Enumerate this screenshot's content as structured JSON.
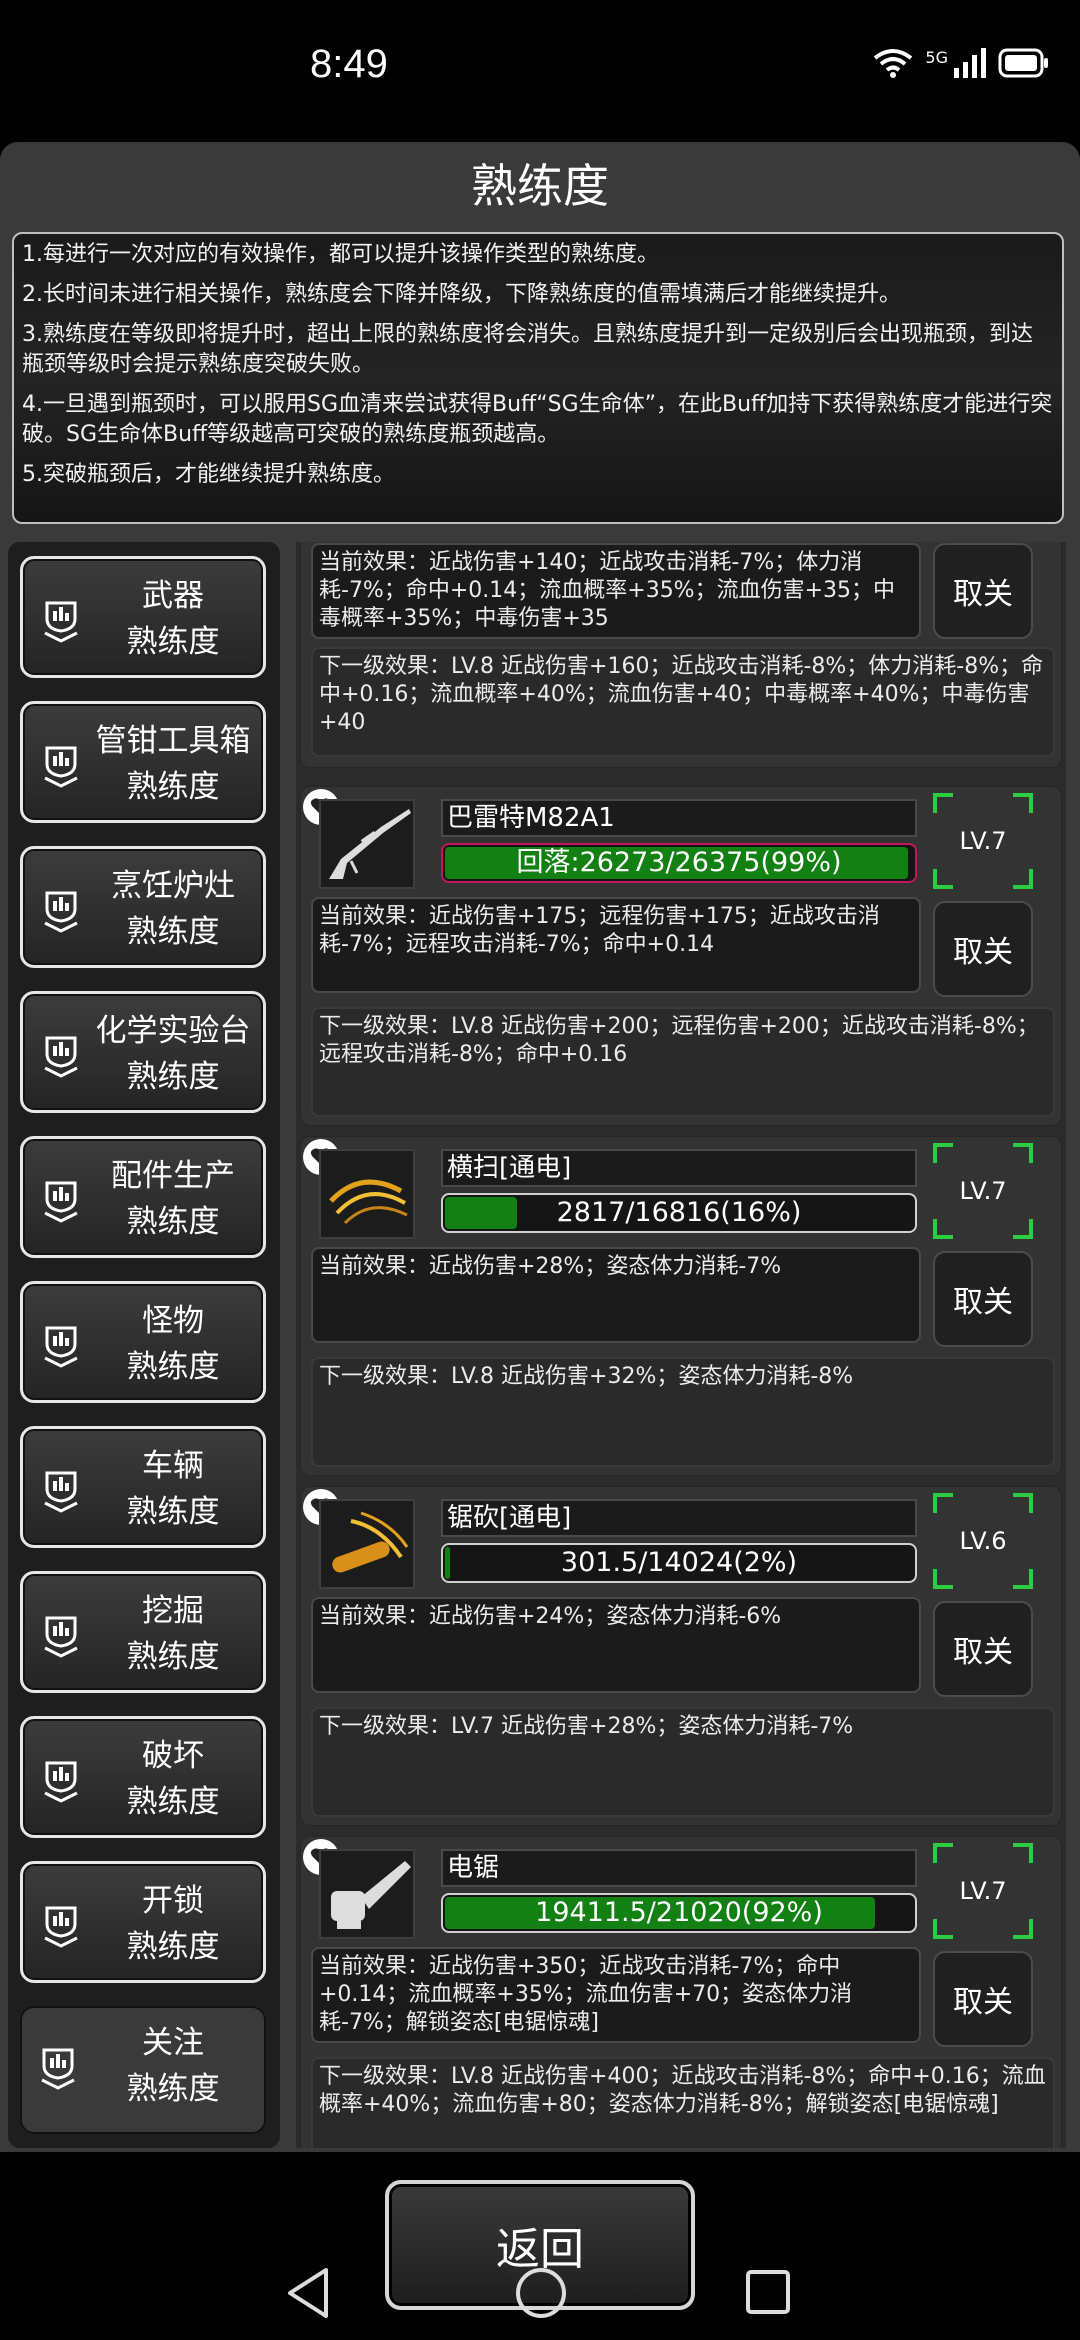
{
  "status_bar": {
    "time": "8:49",
    "network": "5G"
  },
  "title": "熟练度",
  "rules": [
    "1.每进行一次对应的有效操作，都可以提升该操作类型的熟练度。",
    "2.长时间未进行相关操作，熟练度会下降并降级，下降熟练度的值需填满后才能继续提升。",
    "3.熟练度在等级即将提升时，超出上限的熟练度将会消失。且熟练度提升到一定级别后会出现瓶颈，到达瓶颈等级时会提示熟练度突破失败。",
    "4.一旦遇到瓶颈时，可以服用SG血清来尝试获得Buff“SG生命体”，在此Buff加持下获得熟练度才能进行突破。SG生命体Buff等级越高可突破的熟练度瓶颈越高。",
    "5.突破瓶颈后，才能继续提升熟练度。"
  ],
  "menu": [
    {
      "line1": "武器",
      "line2": "熟练度"
    },
    {
      "line1": "管钳工具箱",
      "line2": "熟练度"
    },
    {
      "line1": "烹饪炉灶",
      "line2": "熟练度"
    },
    {
      "line1": "化学实验台",
      "line2": "熟练度"
    },
    {
      "line1": "配件生产",
      "line2": "熟练度"
    },
    {
      "line1": "怪物",
      "line2": "熟练度"
    },
    {
      "line1": "车辆",
      "line2": "熟练度"
    },
    {
      "line1": "挖掘",
      "line2": "熟练度"
    },
    {
      "line1": "破坏",
      "line2": "熟练度"
    },
    {
      "line1": "开锁",
      "line2": "熟练度"
    },
    {
      "line1": "关注",
      "line2": "熟练度",
      "active": true
    }
  ],
  "partial_card": {
    "current": "当前效果：近战伤害+140；近战攻击消耗-7%；体力消耗-7%；命中+0.14；流血概率+35%；流血伤害+35；中毒概率+35%；中毒伤害+35",
    "next": "下一级效果：LV.8 近战伤害+160；近战攻击消耗-8%；体力消耗-8%；命中+0.16；流血概率+40%；流血伤害+40；中毒概率+40%；中毒伤害+40",
    "button": "取关"
  },
  "cards": [
    {
      "name": "巴雷特M82A1",
      "icon": "sniper-rifle-icon",
      "progress_text": "回落:26273/26375(99%)",
      "progress": 0.99,
      "highlight": true,
      "level": "LV.7",
      "current": "当前效果：近战伤害+175；远程伤害+175；近战攻击消耗-7%；远程攻击消耗-7%；命中+0.14",
      "next": "下一级效果：LV.8 近战伤害+200；远程伤害+200；近战攻击消耗-8%；远程攻击消耗-8%；命中+0.16",
      "button": "取关"
    },
    {
      "name": "横扫[通电]",
      "icon": "sweep-slash-icon",
      "progress_text": "2817/16816(16%)",
      "progress": 0.16,
      "highlight": false,
      "level": "LV.7",
      "current": "当前效果：近战伤害+28%；姿态体力消耗-7%",
      "next": "下一级效果：LV.8 近战伤害+32%；姿态体力消耗-8%",
      "button": "取关"
    },
    {
      "name": "锯砍[通电]",
      "icon": "saw-slash-icon",
      "progress_text": "301.5/14024(2%)",
      "progress": 0.02,
      "highlight": false,
      "level": "LV.6",
      "current": "当前效果：近战伤害+24%；姿态体力消耗-6%",
      "next": "下一级效果：LV.7 近战伤害+28%；姿态体力消耗-7%",
      "button": "取关"
    },
    {
      "name": "电锯",
      "icon": "chainsaw-icon",
      "progress_text": "19411.5/21020(92%)",
      "progress": 0.92,
      "highlight": false,
      "level": "LV.7",
      "current": "当前效果：近战伤害+350；近战攻击消耗-7%；命中+0.14；流血概率+35%；流血伤害+70；姿态体力消耗-7%；解锁姿态[电锯惊魂]",
      "next": "下一级效果：LV.8 近战伤害+400；近战攻击消耗-8%；命中+0.16；流血概率+40%；流血伤害+80；姿态体力消耗-8%；解锁姿态[电锯惊魂]",
      "button": "取关"
    }
  ],
  "back_button": "返回"
}
